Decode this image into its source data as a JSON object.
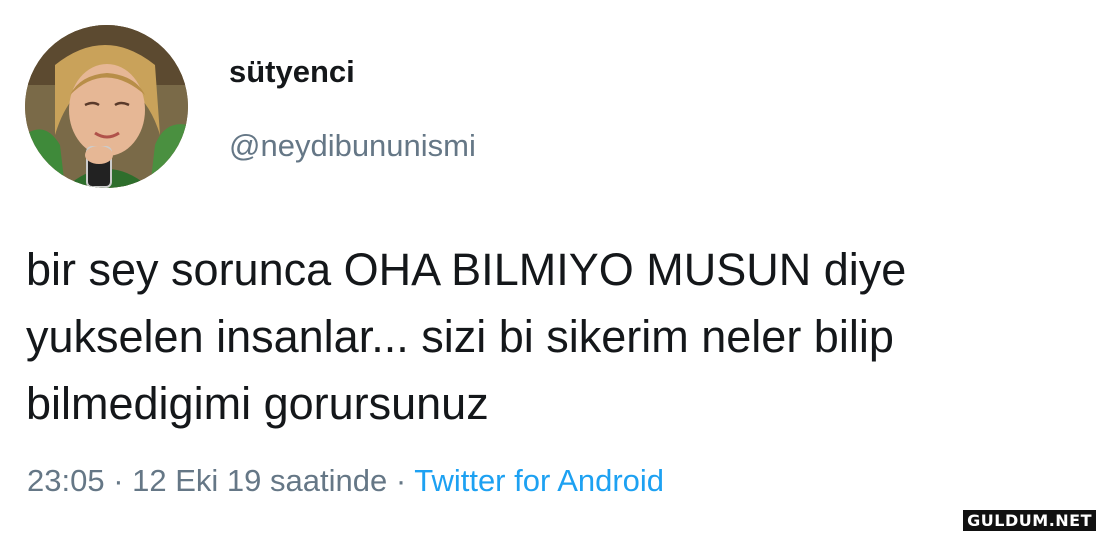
{
  "tweet": {
    "display_name": "sütyenci",
    "handle": "@neydibununismi",
    "text_lines": [
      "bir sey sorunca OHA BILMIYO MUSUN diye",
      "yukselen insanlar... sizi bi sikerim neler bilip",
      "bilmedigimi gorursunuz"
    ],
    "time": "23:05",
    "separator": " · ",
    "date": "12 Eki 19 saatinde",
    "source": "Twitter for Android"
  },
  "watermark": "GULDUM.NET",
  "colors": {
    "text": "#14171a",
    "secondary": "#657786",
    "link": "#1da1f2"
  },
  "icons": {
    "avatar": "profile-photo"
  }
}
